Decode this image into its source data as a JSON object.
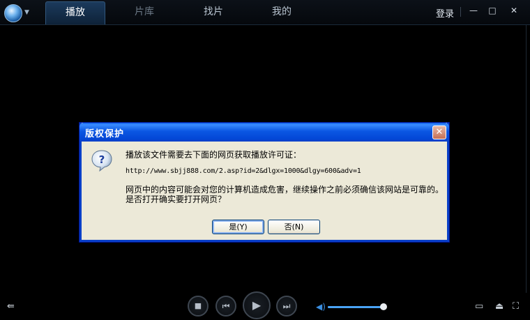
{
  "app": {
    "tabs": [
      {
        "label": "播放",
        "active": true
      },
      {
        "label": "片库",
        "active": false
      },
      {
        "label": "找片",
        "active": false
      },
      {
        "label": "我的",
        "active": false
      }
    ],
    "login_label": "登录",
    "window_buttons": {
      "minimize": "—",
      "maximize": "□",
      "close": "✕"
    }
  },
  "dialog": {
    "title": "版权保护",
    "close_glyph": "✕",
    "message_line1": "播放该文件需要去下面的网页获取播放许可证：",
    "url": "http://www.sbjj888.com/2.asp?id=2&dlgx=1000&dlgy=600&adv=1",
    "warning_line1": "网页中的内容可能会对您的计算机造成危害，继续操作之前必须确信该网站是可靠的。",
    "warning_line2": "是否打开确实要打开网页？",
    "yes_label": "是(Y)",
    "no_label": "否(N)"
  },
  "controls": {
    "stop_glyph": "■",
    "prev_glyph": "⏮",
    "play_glyph": "▶",
    "next_glyph": "⏭",
    "volume_level": 1.0,
    "icons": [
      "playlist-icon",
      "volume-icon",
      "screen-icon",
      "eject-icon",
      "fullscreen-icon"
    ]
  },
  "colors": {
    "dialog_title_blue": "#0a57e3",
    "dialog_bg": "#ece9d8",
    "volume_blue": "#3a8ee0"
  }
}
